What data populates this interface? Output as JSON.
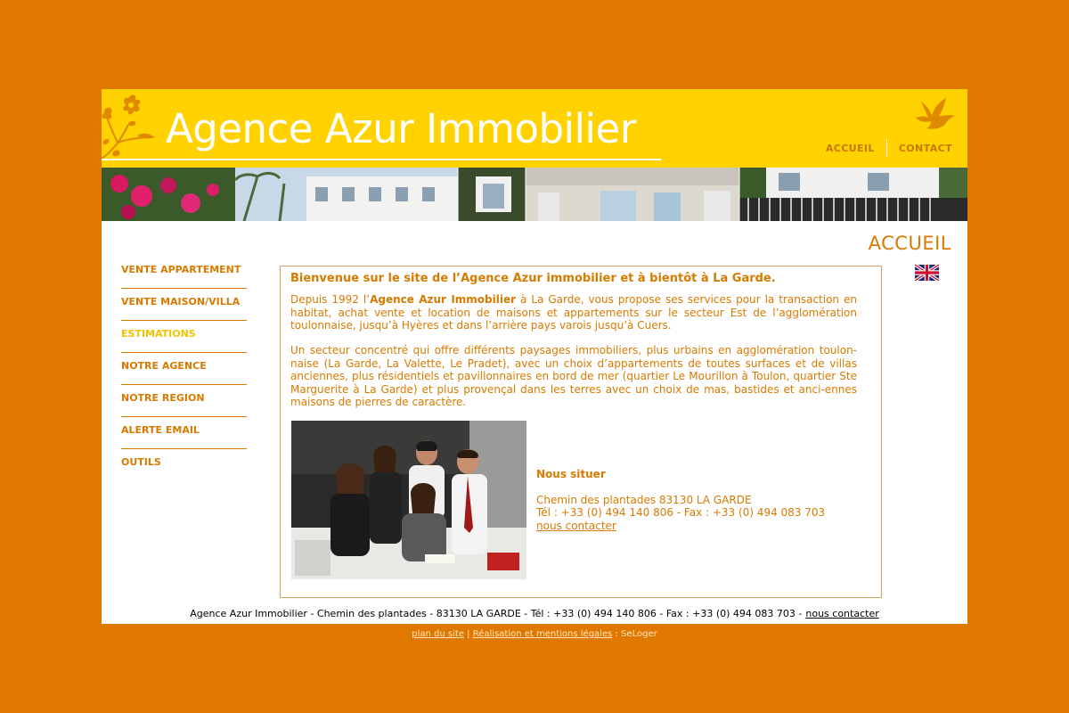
{
  "colors": {
    "page_background": "#E07800",
    "header_background": "#FFD200",
    "accent": "#D97A00",
    "active_nav": "#F2C100"
  },
  "header": {
    "title": "Agence Azur Immobilier",
    "logo_icon": "flower-branch-icon",
    "bird_icon": "dove-icon",
    "nav": {
      "home": "ACCUEIL",
      "contact": "CONTACT"
    }
  },
  "page_heading": "ACCUEIL",
  "language_flag": "uk-flag-icon",
  "sidebar": {
    "items": [
      {
        "label": "VENTE APPARTEMENT",
        "active": false
      },
      {
        "label": "VENTE MAISON/VILLA",
        "active": false
      },
      {
        "label": "ESTIMATIONS",
        "active": true
      },
      {
        "label": "NOTRE AGENCE",
        "active": false
      },
      {
        "label": "NOTRE REGION",
        "active": false
      },
      {
        "label": "ALERTE EMAIL",
        "active": false
      },
      {
        "label": "OUTILS",
        "active": false
      }
    ]
  },
  "main": {
    "welcome": "Bienvenue sur le site de l’Agence Azur immobilier et à bientôt à La Garde.",
    "p1_before": "Depuis 1992 l’",
    "p1_bold": "Agence Azur Immobilier",
    "p1_after": " à La Garde, vous propose ses services pour la transaction en habitat, achat vente et location de maisons et appartements sur le secteur Est de l’agglomération toulonnaise, jusqu’à Hyères et dans l’arrière pays varois jusqu’à Cuers.",
    "p2": "Un secteur concentré qui offre différents paysages immobiliers, plus urbains en agglomération toulon-naise (La Garde, La Valette, Le Pradet), avec un choix d’appartements de toutes surfaces et de villas anciennes, plus résidentiels et pavillonnaires en bord de mer (quartier Le Mourillon à Toulon, quartier Ste Marguerite à La Garde) et plus provençal dans les terres avec un choix de mas, bastides et anci-ennes maisons de pierres de caractère."
  },
  "contact": {
    "heading": "Nous situer",
    "address": "Chemin des plantades 83130 LA GARDE",
    "phone": "Tél : +33 (0) 494 140 806 - Fax : +33 (0) 494 083 703",
    "link": "nous contacter"
  },
  "footer": {
    "text": "Agence Azur Immobilier - Chemin des plantades - 83130 LA GARDE - Tél : +33 (0) 494 140 806 - Fax : +33 (0) 494 083 703 -",
    "link": "nous contacter"
  },
  "bottom": {
    "sitemap": "plan du site",
    "sep": "|",
    "legal": "Réalisation et mentions légales",
    "credit": ": SeLoger"
  }
}
